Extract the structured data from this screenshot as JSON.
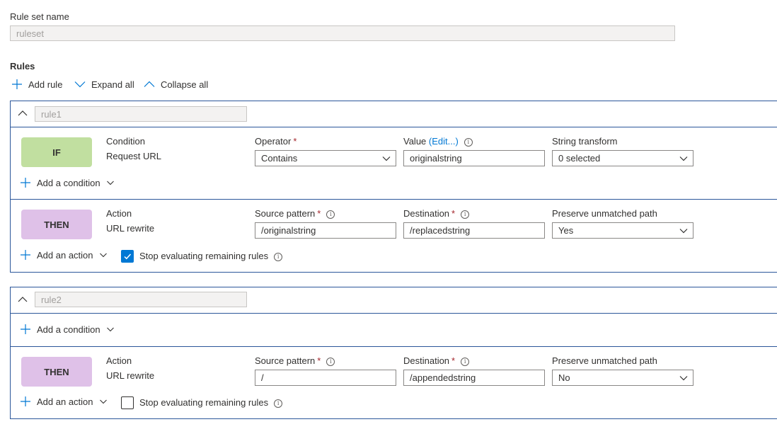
{
  "ruleset": {
    "label": "Rule set name",
    "value": "ruleset"
  },
  "rules_heading": "Rules",
  "toolbar": {
    "add_rule": "Add rule",
    "expand_all": "Expand all",
    "collapse_all": "Collapse all"
  },
  "rule1": {
    "name": "rule1",
    "condition": {
      "badge": "IF",
      "title": "Condition",
      "subtitle": "Request URL",
      "operator_label": "Operator",
      "operator_value": "Contains",
      "value_label": "Value",
      "value_edit": "(Edit...)",
      "value_value": "originalstring",
      "transform_label": "String transform",
      "transform_value": "0 selected"
    },
    "add_condition": "Add a condition",
    "action": {
      "badge": "THEN",
      "title": "Action",
      "subtitle": "URL rewrite",
      "source_label": "Source pattern",
      "source_value": "/originalstring",
      "dest_label": "Destination",
      "dest_value": "/replacedstring",
      "preserve_label": "Preserve unmatched path",
      "preserve_value": "Yes"
    },
    "add_action": "Add an action",
    "stop_label": "Stop evaluating remaining rules",
    "stop_checked": true
  },
  "rule2": {
    "name": "rule2",
    "add_condition": "Add a condition",
    "action": {
      "badge": "THEN",
      "title": "Action",
      "subtitle": "URL rewrite",
      "source_label": "Source pattern",
      "source_value": "/",
      "dest_label": "Destination",
      "dest_value": "/appendedstring",
      "preserve_label": "Preserve unmatched path",
      "preserve_value": "No"
    },
    "add_action": "Add an action",
    "stop_label": "Stop evaluating remaining rules",
    "stop_checked": false
  },
  "colors": {
    "accent": "#0078d4",
    "if_badge": "#c1dfa0",
    "then_badge": "#dfc1e8",
    "rule_border": "#2b579a",
    "required": "#a4262c"
  },
  "icons": {
    "add": "plus-icon",
    "expand": "chevron-down-icon",
    "collapse": "chevron-up-icon",
    "info": "info-icon",
    "check": "checkmark-icon"
  }
}
